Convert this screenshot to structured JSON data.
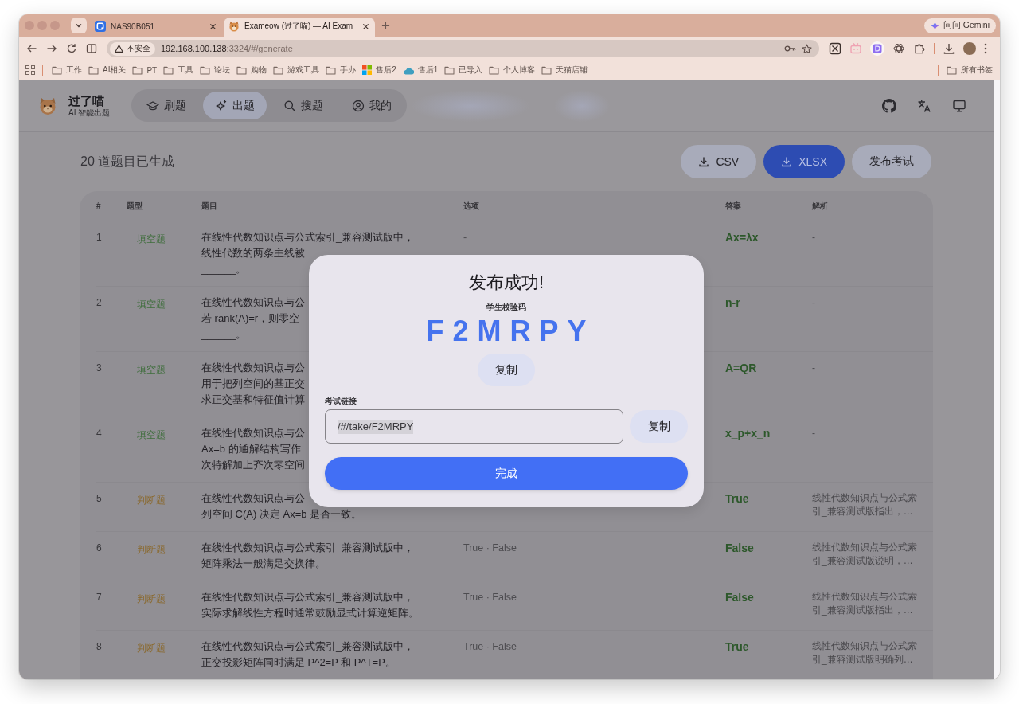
{
  "browser": {
    "tabs": [
      {
        "title": "NAS90B051",
        "selected": false
      },
      {
        "title": "Exameow (过了喵) — AI Exam",
        "selected": true
      }
    ],
    "gemini_button": "问问 Gemini",
    "security_chip": "不安全",
    "url": {
      "host": "192.168.100.138",
      "path": ":3324/#/generate"
    },
    "bookmarks": [
      {
        "label": "工作",
        "kind": "folder"
      },
      {
        "label": "AI相关",
        "kind": "folder"
      },
      {
        "label": "PT",
        "kind": "folder"
      },
      {
        "label": "工具",
        "kind": "folder"
      },
      {
        "label": "论坛",
        "kind": "folder"
      },
      {
        "label": "购物",
        "kind": "folder"
      },
      {
        "label": "游戏工具",
        "kind": "folder"
      },
      {
        "label": "手办",
        "kind": "folder"
      },
      {
        "label": "售后2",
        "kind": "windows"
      },
      {
        "label": "售后1",
        "kind": "cloud"
      },
      {
        "label": "已导入",
        "kind": "folder"
      },
      {
        "label": "个人博客",
        "kind": "folder"
      },
      {
        "label": "天猫店铺",
        "kind": "folder"
      }
    ],
    "all_bookmarks": "所有书签"
  },
  "app_header": {
    "brand": {
      "name": "过了喵",
      "tagline": "AI 智能出题"
    },
    "nav": [
      {
        "label": "刷题",
        "kind": "practice",
        "selected": false
      },
      {
        "label": "出题",
        "kind": "generate",
        "selected": true
      },
      {
        "label": "搜题",
        "kind": "search",
        "selected": false
      },
      {
        "label": "我的",
        "kind": "profile",
        "selected": false
      }
    ]
  },
  "summary": "20 道题目已生成",
  "actions": [
    {
      "label": "CSV",
      "kind": "download",
      "primary": false
    },
    {
      "label": "XLSX",
      "kind": "download",
      "primary": true
    },
    {
      "label": "发布考试",
      "kind": "plain",
      "primary": false
    }
  ],
  "table": {
    "columns": [
      "#",
      "题型",
      "题目",
      "选项",
      "答案",
      "解析"
    ],
    "rows": [
      {
        "number": "1",
        "kind": "fill",
        "type": "填空题",
        "question": [
          "在线性代数知识点与公式索引_兼容测试版中，",
          "线性代数的两条主线被",
          "______。"
        ],
        "options": "-",
        "answer": "Ax=λx",
        "explanation": "-"
      },
      {
        "number": "2",
        "kind": "fill",
        "type": "填空题",
        "question": [
          "在线性代数知识点与公",
          "若 rank(A)=r，则零空",
          "______。"
        ],
        "answer": "n-r",
        "explanation": "-"
      },
      {
        "number": "3",
        "kind": "fill",
        "type": "填空题",
        "question": [
          "在线性代数知识点与公",
          "用于把列空间的基正交",
          "求正交基和特征值计算"
        ],
        "answer": "A=QR",
        "explanation": "-"
      },
      {
        "number": "4",
        "kind": "fill",
        "type": "填空题",
        "question": [
          "在线性代数知识点与公",
          "Ax=b 的通解结构写作",
          "次特解加上齐次零空间"
        ],
        "answer": "x_p+x_n",
        "explanation": "-"
      },
      {
        "number": "5",
        "kind": "judge",
        "type": "判断题",
        "question": [
          "在线性代数知识点与公",
          "列空间 C(A) 决定 Ax=b 是否一致。"
        ],
        "answer": "True",
        "explanation": "线性代数知识点与公式索引_兼容测试版指出，…"
      },
      {
        "number": "6",
        "kind": "judge",
        "type": "判断题",
        "question": [
          "在线性代数知识点与公式索引_兼容测试版中，矩阵乘法一般满足交换律。"
        ],
        "options": "True · False",
        "answer": "False",
        "explanation": "线性代数知识点与公式索引_兼容测试版说明，…"
      },
      {
        "number": "7",
        "kind": "judge",
        "type": "判断题",
        "question": [
          "在线性代数知识点与公式索引_兼容测试版中，实际求解线性方程时通常鼓励显式计算逆矩阵。"
        ],
        "options": "True · False",
        "answer": "False",
        "explanation": "线性代数知识点与公式索引_兼容测试版指出，…"
      },
      {
        "number": "8",
        "kind": "judge",
        "type": "判断题",
        "question": [
          "在线性代数知识点与公式索引_兼容测试版中，正交投影矩阵同时满足 P^2=P 和 P^T=P。"
        ],
        "options": "True · False",
        "answer": "True",
        "explanation": "线性代数知识点与公式索引_兼容测试版明确列…"
      }
    ]
  },
  "dialog": {
    "title": "发布成功!",
    "code_label": "学生校验码",
    "code": "F2MRPY",
    "copy_code": "复制",
    "link_label": "考试链接",
    "link": "/#/take/F2MRPY",
    "link_selected": true,
    "copy_link": "复制",
    "done": "完成"
  }
}
